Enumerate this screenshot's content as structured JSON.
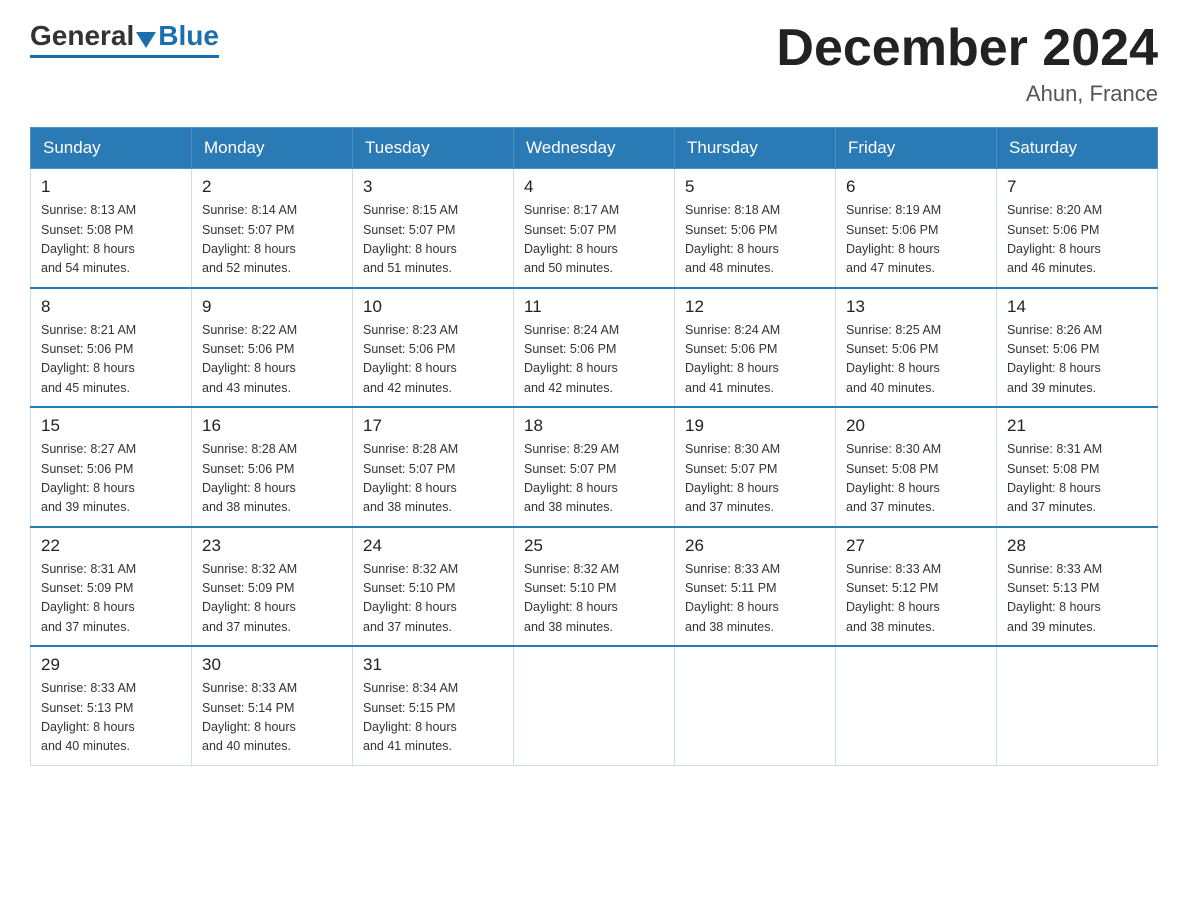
{
  "header": {
    "logo_general": "General",
    "logo_blue": "Blue",
    "month_title": "December 2024",
    "location": "Ahun, France"
  },
  "days_of_week": [
    "Sunday",
    "Monday",
    "Tuesday",
    "Wednesday",
    "Thursday",
    "Friday",
    "Saturday"
  ],
  "weeks": [
    [
      {
        "day": "1",
        "sunrise": "8:13 AM",
        "sunset": "5:08 PM",
        "daylight": "8 hours and 54 minutes."
      },
      {
        "day": "2",
        "sunrise": "8:14 AM",
        "sunset": "5:07 PM",
        "daylight": "8 hours and 52 minutes."
      },
      {
        "day": "3",
        "sunrise": "8:15 AM",
        "sunset": "5:07 PM",
        "daylight": "8 hours and 51 minutes."
      },
      {
        "day": "4",
        "sunrise": "8:17 AM",
        "sunset": "5:07 PM",
        "daylight": "8 hours and 50 minutes."
      },
      {
        "day": "5",
        "sunrise": "8:18 AM",
        "sunset": "5:06 PM",
        "daylight": "8 hours and 48 minutes."
      },
      {
        "day": "6",
        "sunrise": "8:19 AM",
        "sunset": "5:06 PM",
        "daylight": "8 hours and 47 minutes."
      },
      {
        "day": "7",
        "sunrise": "8:20 AM",
        "sunset": "5:06 PM",
        "daylight": "8 hours and 46 minutes."
      }
    ],
    [
      {
        "day": "8",
        "sunrise": "8:21 AM",
        "sunset": "5:06 PM",
        "daylight": "8 hours and 45 minutes."
      },
      {
        "day": "9",
        "sunrise": "8:22 AM",
        "sunset": "5:06 PM",
        "daylight": "8 hours and 43 minutes."
      },
      {
        "day": "10",
        "sunrise": "8:23 AM",
        "sunset": "5:06 PM",
        "daylight": "8 hours and 42 minutes."
      },
      {
        "day": "11",
        "sunrise": "8:24 AM",
        "sunset": "5:06 PM",
        "daylight": "8 hours and 42 minutes."
      },
      {
        "day": "12",
        "sunrise": "8:24 AM",
        "sunset": "5:06 PM",
        "daylight": "8 hours and 41 minutes."
      },
      {
        "day": "13",
        "sunrise": "8:25 AM",
        "sunset": "5:06 PM",
        "daylight": "8 hours and 40 minutes."
      },
      {
        "day": "14",
        "sunrise": "8:26 AM",
        "sunset": "5:06 PM",
        "daylight": "8 hours and 39 minutes."
      }
    ],
    [
      {
        "day": "15",
        "sunrise": "8:27 AM",
        "sunset": "5:06 PM",
        "daylight": "8 hours and 39 minutes."
      },
      {
        "day": "16",
        "sunrise": "8:28 AM",
        "sunset": "5:06 PM",
        "daylight": "8 hours and 38 minutes."
      },
      {
        "day": "17",
        "sunrise": "8:28 AM",
        "sunset": "5:07 PM",
        "daylight": "8 hours and 38 minutes."
      },
      {
        "day": "18",
        "sunrise": "8:29 AM",
        "sunset": "5:07 PM",
        "daylight": "8 hours and 38 minutes."
      },
      {
        "day": "19",
        "sunrise": "8:30 AM",
        "sunset": "5:07 PM",
        "daylight": "8 hours and 37 minutes."
      },
      {
        "day": "20",
        "sunrise": "8:30 AM",
        "sunset": "5:08 PM",
        "daylight": "8 hours and 37 minutes."
      },
      {
        "day": "21",
        "sunrise": "8:31 AM",
        "sunset": "5:08 PM",
        "daylight": "8 hours and 37 minutes."
      }
    ],
    [
      {
        "day": "22",
        "sunrise": "8:31 AM",
        "sunset": "5:09 PM",
        "daylight": "8 hours and 37 minutes."
      },
      {
        "day": "23",
        "sunrise": "8:32 AM",
        "sunset": "5:09 PM",
        "daylight": "8 hours and 37 minutes."
      },
      {
        "day": "24",
        "sunrise": "8:32 AM",
        "sunset": "5:10 PM",
        "daylight": "8 hours and 37 minutes."
      },
      {
        "day": "25",
        "sunrise": "8:32 AM",
        "sunset": "5:10 PM",
        "daylight": "8 hours and 38 minutes."
      },
      {
        "day": "26",
        "sunrise": "8:33 AM",
        "sunset": "5:11 PM",
        "daylight": "8 hours and 38 minutes."
      },
      {
        "day": "27",
        "sunrise": "8:33 AM",
        "sunset": "5:12 PM",
        "daylight": "8 hours and 38 minutes."
      },
      {
        "day": "28",
        "sunrise": "8:33 AM",
        "sunset": "5:13 PM",
        "daylight": "8 hours and 39 minutes."
      }
    ],
    [
      {
        "day": "29",
        "sunrise": "8:33 AM",
        "sunset": "5:13 PM",
        "daylight": "8 hours and 40 minutes."
      },
      {
        "day": "30",
        "sunrise": "8:33 AM",
        "sunset": "5:14 PM",
        "daylight": "8 hours and 40 minutes."
      },
      {
        "day": "31",
        "sunrise": "8:34 AM",
        "sunset": "5:15 PM",
        "daylight": "8 hours and 41 minutes."
      },
      null,
      null,
      null,
      null
    ]
  ],
  "labels": {
    "sunrise": "Sunrise:",
    "sunset": "Sunset:",
    "daylight": "Daylight:"
  }
}
